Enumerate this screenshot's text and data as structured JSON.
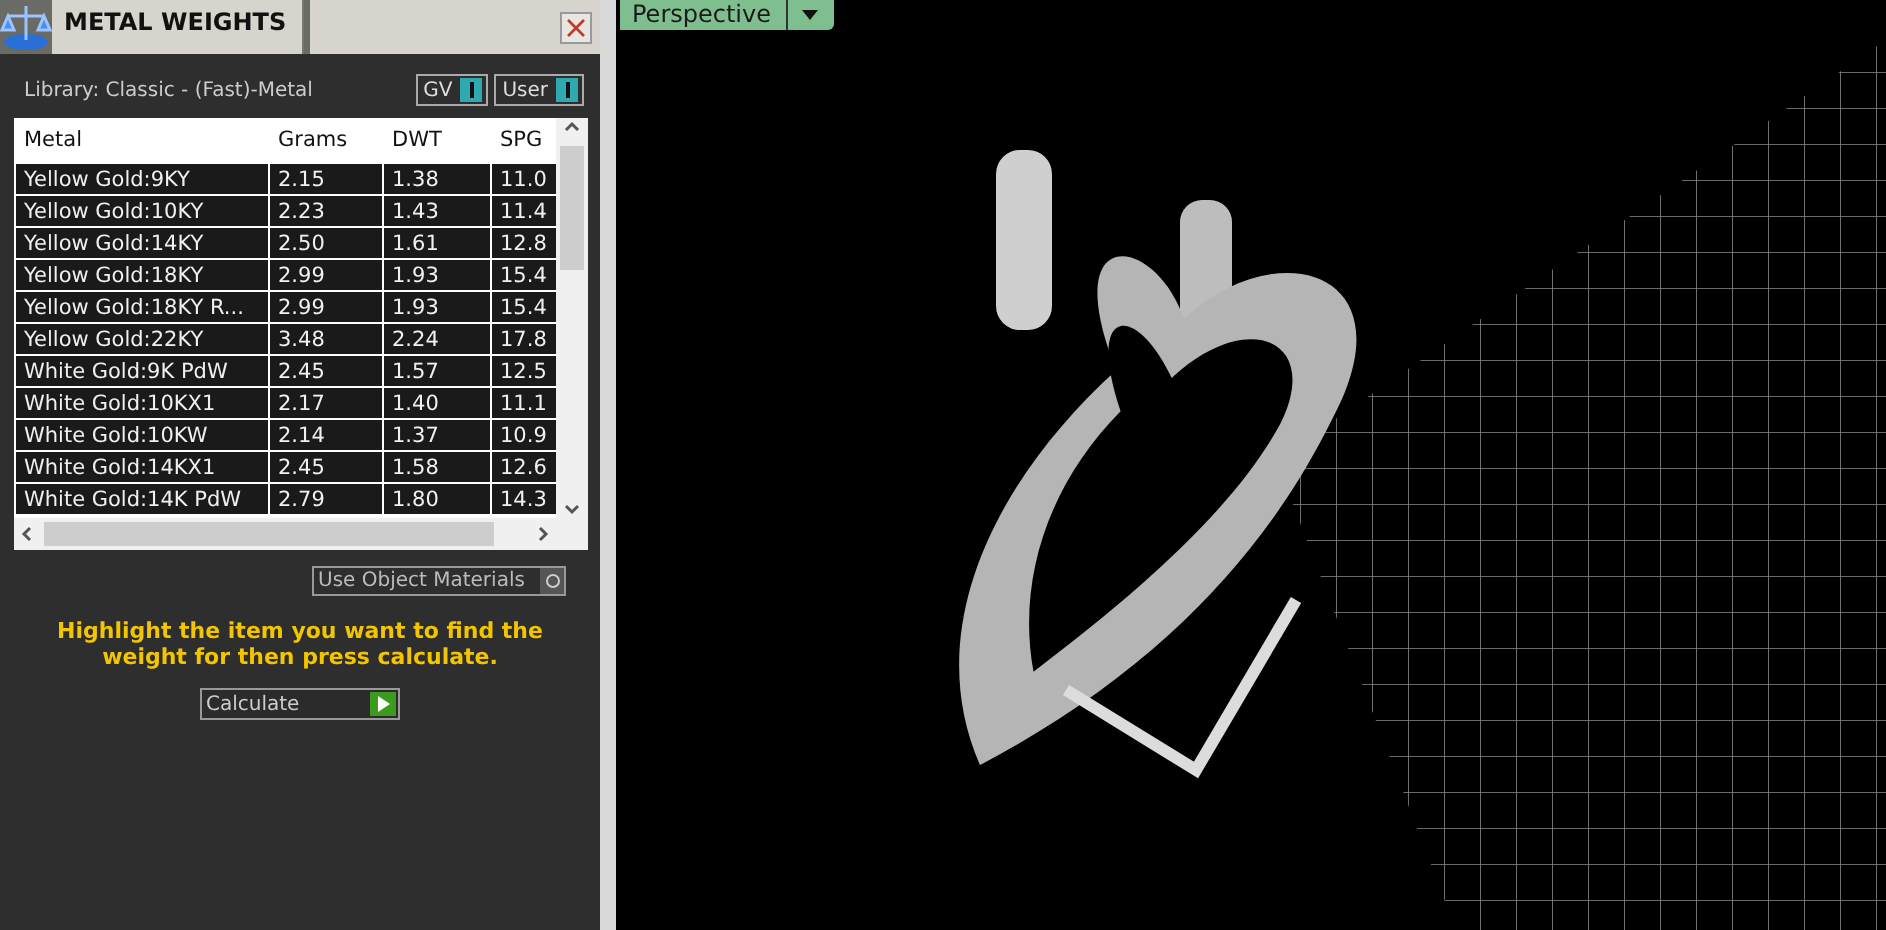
{
  "panel": {
    "title": "METAL WEIGHTS",
    "library": "Library: Classic - (Fast)-Metal",
    "toggles": [
      {
        "label": "GV",
        "on": true
      },
      {
        "label": "User",
        "on": true
      }
    ],
    "table": {
      "columns": [
        "Metal",
        "Grams",
        "DWT",
        "SPG"
      ],
      "rows": [
        [
          "Yellow Gold:9KY",
          "2.15",
          "1.38",
          "11.0"
        ],
        [
          "Yellow Gold:10KY",
          "2.23",
          "1.43",
          "11.4"
        ],
        [
          "Yellow Gold:14KY",
          "2.50",
          "1.61",
          "12.8"
        ],
        [
          "Yellow Gold:18KY",
          "2.99",
          "1.93",
          "15.4"
        ],
        [
          "Yellow Gold:18KY R...",
          "2.99",
          "1.93",
          "15.4"
        ],
        [
          "Yellow Gold:22KY",
          "3.48",
          "2.24",
          "17.8"
        ],
        [
          "White Gold:9K PdW",
          "2.45",
          "1.57",
          "12.5"
        ],
        [
          "White Gold:10KX1",
          "2.17",
          "1.40",
          "11.1"
        ],
        [
          "White Gold:10KW",
          "2.14",
          "1.37",
          "10.9"
        ],
        [
          "White Gold:14KX1",
          "2.45",
          "1.58",
          "12.6"
        ],
        [
          "White Gold:14K PdW",
          "2.79",
          "1.80",
          "14.3"
        ]
      ]
    },
    "option": {
      "label": "Use Object Materials",
      "checked": false
    },
    "instruction": "Highlight the item you want to find the weight for then press calculate.",
    "calculate": "Calculate"
  },
  "viewport": {
    "view_label": "Perspective"
  }
}
